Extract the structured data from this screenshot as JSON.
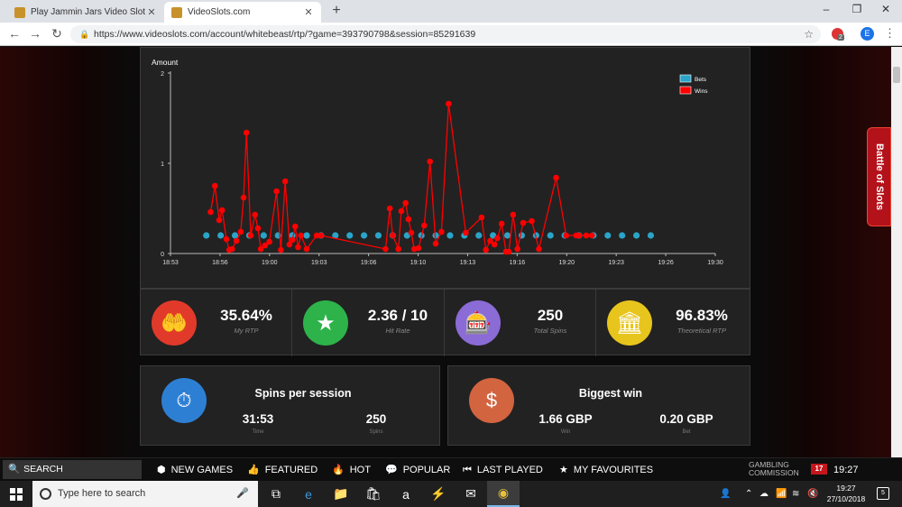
{
  "browser": {
    "tabs": [
      {
        "title": "Play Jammin Jars Video Slot Free",
        "active": false
      },
      {
        "title": "VideoSlots.com",
        "active": true
      }
    ],
    "new_tab": "+",
    "close_glyph": "✕",
    "url": "https://www.videoslots.com/account/whitebeast/rtp/?game=393790798&session=85291639",
    "profile_initial": "E",
    "extension_badge": "2"
  },
  "chart_data": {
    "type": "line",
    "ylabel": "Amount",
    "xlabel": "",
    "ylim": [
      0,
      2
    ],
    "yticks": [
      "0",
      "1",
      "2"
    ],
    "xticks": [
      "18:53",
      "18:56",
      "19:00",
      "19:03",
      "19:06",
      "19:10",
      "19:13",
      "19:16",
      "19:20",
      "19:23",
      "19:26",
      "19:30"
    ],
    "legend_position": "top-right",
    "series": [
      {
        "name": "Bets",
        "color": "#2aa4c8",
        "x": [
          2.5,
          3.5,
          4.5,
          5.5,
          6.5,
          7.5,
          8.5,
          9.5,
          10.5,
          11.5,
          12.5,
          13.5,
          14.5,
          15.5,
          16.5,
          17.5,
          18.5,
          19.5,
          20.5,
          21.5,
          22.5,
          23.5,
          24.5,
          25.5,
          26.5,
          27.5,
          28.5,
          29.5,
          30.5,
          31.5,
          32.5,
          33.5
        ],
        "values": [
          0.2,
          0.2,
          0.2,
          0.2,
          0.2,
          0.2,
          0.2,
          0.2,
          0.2,
          0.2,
          0.2,
          0.2,
          0.2,
          0.2,
          0.2,
          0.2,
          0.2,
          0.2,
          0.2,
          0.2,
          0.2,
          0.2,
          0.2,
          0.2,
          0.2,
          0.2,
          0.2,
          0.2,
          0.2,
          0.2,
          0.2,
          0.2
        ]
      },
      {
        "name": "Wins",
        "color": "#ff0000",
        "x": [
          2.8,
          3.1,
          3.4,
          3.6,
          3.9,
          4.1,
          4.3,
          4.6,
          4.9,
          5.1,
          5.3,
          5.6,
          5.9,
          6.1,
          6.3,
          6.6,
          6.9,
          7.4,
          7.7,
          8.0,
          8.3,
          8.5,
          8.7,
          8.9,
          9.1,
          9.5,
          10.2,
          10.5,
          15.0,
          15.3,
          15.5,
          15.9,
          16.1,
          16.4,
          16.6,
          16.8,
          17.0,
          17.3,
          17.7,
          18.1,
          18.5,
          18.9,
          19.4,
          20.6,
          21.7,
          22.0,
          22.3,
          22.6,
          22.8,
          23.1,
          23.4,
          23.6,
          23.9,
          24.2,
          24.6,
          25.2,
          25.7,
          26.9,
          27.6,
          28.3,
          28.5,
          29.0,
          29.4
        ],
        "values": [
          0.46,
          0.75,
          0.37,
          0.48,
          0.16,
          0.04,
          0.05,
          0.14,
          0.24,
          0.62,
          1.34,
          0.2,
          0.43,
          0.28,
          0.05,
          0.09,
          0.13,
          0.69,
          0.04,
          0.8,
          0.1,
          0.15,
          0.3,
          0.07,
          0.2,
          0.05,
          0.2,
          0.2,
          0.05,
          0.5,
          0.2,
          0.05,
          0.47,
          0.56,
          0.38,
          0.23,
          0.05,
          0.06,
          0.31,
          1.02,
          0.11,
          0.24,
          1.66,
          0.23,
          0.4,
          0.04,
          0.14,
          0.1,
          0.17,
          0.33,
          0.02,
          0.02,
          0.43,
          0.05,
          0.34,
          0.36,
          0.05,
          0.84,
          0.2,
          0.2,
          0.2,
          0.2,
          0.2
        ]
      }
    ]
  },
  "stats": [
    {
      "value": "35.64%",
      "label": "My RTP",
      "icon": "hand-money-icon",
      "color": "#e23a2a"
    },
    {
      "value": "2.36 / 10",
      "label": "Hit Rate",
      "icon": "star-icon",
      "color": "#2db34a"
    },
    {
      "value": "250",
      "label": "Total Spins",
      "icon": "slot-machine-icon",
      "color": "#8b6bd6"
    },
    {
      "value": "96.83%",
      "label": "Theoretical RTP",
      "icon": "building-icon",
      "color": "#e7c51c"
    }
  ],
  "spins_per_session": {
    "title": "Spins per session",
    "time_value": "31:53",
    "time_label": "Time",
    "spins_value": "250",
    "spins_label": "Spins",
    "icon_color": "#2d7fd3"
  },
  "biggest_win": {
    "title": "Biggest win",
    "win_value": "1.66 GBP",
    "win_label": "Win",
    "bet_value": "0.20 GBP",
    "bet_label": "Bet",
    "icon_color": "#d2643f"
  },
  "battle_tab": "Battle of Slots",
  "sitebar": {
    "search": "SEARCH",
    "items": [
      "NEW GAMES",
      "FEATURED",
      "HOT",
      "POPULAR",
      "LAST PLAYED",
      "MY FAVOURITES"
    ],
    "gambling_line1": "GAMBLING",
    "gambling_line2": "COMMISSION",
    "age": "17",
    "time": "19:27"
  },
  "taskbar": {
    "search_placeholder": "Type here to search",
    "time": "19:27",
    "date": "27/10/2018",
    "notifications": "5"
  }
}
